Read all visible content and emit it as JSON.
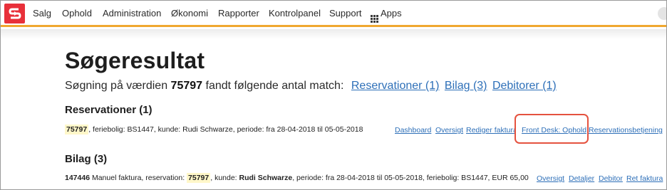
{
  "nav": {
    "items": [
      "Salg",
      "Ophold",
      "Administration",
      "Økonomi",
      "Rapporter",
      "Kontrolpanel",
      "Support"
    ],
    "apps_label": "Apps",
    "accent_color": "#f0a830",
    "logo_color": "#e8303a"
  },
  "page": {
    "title": "Søgeresultat",
    "summary_prefix": "Søgning på værdien",
    "search_value": "75797",
    "summary_suffix": "fandt følgende antal match:",
    "summary_links": [
      "Reservationer (1)",
      "Bilag (3)",
      "Debitorer (1)"
    ]
  },
  "reservations": {
    "heading": "Reservationer (1)",
    "row": {
      "id": "75797",
      "text": ", feriebolig: BS1447, kunde: Rudi Schwarze, periode: fra 28-04-2018 til 05-05-2018"
    },
    "actions": [
      "Dashboard",
      "Oversigt",
      "Rediger faktura",
      "Front Desk: Ophold",
      "Reservationsbetjening"
    ],
    "highlighted_action": "Front Desk: Ophold",
    "highlight_color": "#e5523f"
  },
  "bilag": {
    "heading": "Bilag (3)",
    "row": {
      "number": "147446",
      "text_1": " Manuel faktura, reservation: ",
      "reservation_id": "75797",
      "text_2": ", kunde: ",
      "customer": "Rudi Schwarze",
      "text_3": ", periode: fra 28-04-2018 til 05-05-2018, feriebolig: BS1447, EUR 65,00"
    },
    "actions": [
      "Oversigt",
      "Detaljer",
      "Debitor",
      "Ret faktura"
    ]
  }
}
